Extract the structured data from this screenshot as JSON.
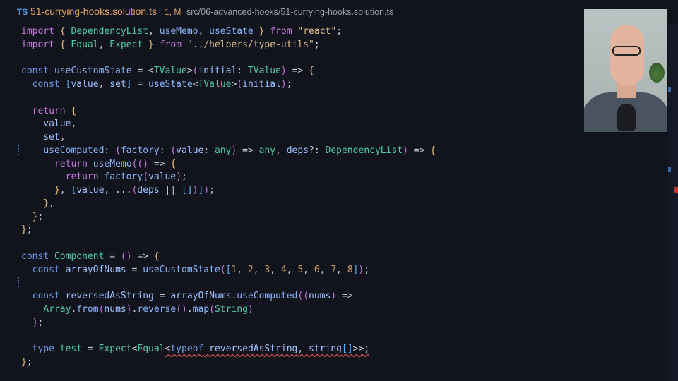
{
  "tab": {
    "language": "TS",
    "filename": "51-currying-hooks.solution.ts",
    "status": "1, M",
    "path": "src/06-advanced-hooks/51-currying-hooks.solution.ts"
  },
  "code_lines": [
    "import { DependencyList, useMemo, useState } from \"react\";",
    "import { Equal, Expect } from \"../helpers/type-utils\";",
    "",
    "const useCustomState = <TValue>(initial: TValue) => {",
    "  const [value, set] = useState<TValue>(initial);",
    "",
    "  return {",
    "    value,",
    "    set,",
    "    useComputed: (factory: (value: any) => any, deps?: DependencyList) => {",
    "      return useMemo(() => {",
    "        return factory(value);",
    "      }, [value, ...(deps || [])]);",
    "    },",
    "  };",
    "};",
    "",
    "const Component = () => {",
    "  const arrayOfNums = useCustomState([1, 2, 3, 4, 5, 6, 7, 8]);",
    "",
    "  const reversedAsString = arrayOfNums.useComputed((nums) =>",
    "    Array.from(nums).reverse().map(String)",
    "  );",
    "",
    "  type test = Expect<Equal<typeof reversedAsString, string[]>>;",
    "};"
  ],
  "webcam": {
    "description_icon": "presenter-webcam"
  },
  "colors": {
    "background": "#11141c",
    "keyword": "#c678dd",
    "string": "#e2c08d",
    "type": "#4ec9b0",
    "number": "#d19a66",
    "tab_modified": "#e2a35c",
    "error": "#e05252"
  }
}
